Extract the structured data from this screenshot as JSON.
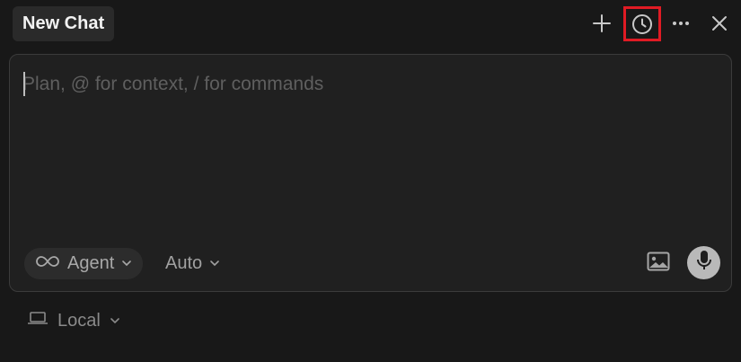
{
  "header": {
    "tab_title": "New Chat",
    "actions": [
      {
        "name": "new-chat",
        "icon": "plus-icon"
      },
      {
        "name": "history",
        "icon": "clock-icon",
        "highlighted": true
      },
      {
        "name": "more",
        "icon": "ellipsis-icon"
      },
      {
        "name": "close",
        "icon": "close-icon"
      }
    ]
  },
  "composer": {
    "placeholder": "Plan, @ for context, / for commands",
    "value": "",
    "mode": {
      "label": "Agent",
      "icon": "infinity-icon"
    },
    "model": {
      "label": "Auto"
    },
    "image_button_icon": "image-icon",
    "mic_button_icon": "microphone-icon"
  },
  "footer": {
    "environment": {
      "label": "Local",
      "icon": "laptop-icon"
    }
  },
  "colors": {
    "background": "#181818",
    "panel": "#202020",
    "highlight": "#e01b24"
  }
}
